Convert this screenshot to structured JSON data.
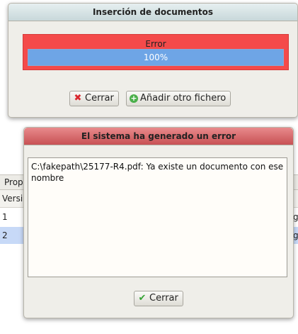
{
  "background": {
    "tab_label": "Prop",
    "column_header": "Versi",
    "rows": [
      {
        "version": "1",
        "trailing": "g"
      },
      {
        "version": "2",
        "trailing": "g"
      }
    ]
  },
  "insert_dialog": {
    "title": "Inserción de documentos",
    "status_label": "Error",
    "progress_percent": 100,
    "progress_text": "100%",
    "close_label": "Cerrar",
    "add_label": "Añadir otro fichero"
  },
  "error_dialog": {
    "title": "El sistema ha generado un error",
    "message": "C:\\fakepath\\25177-R4.pdf: Ya existe un documento con ese nombre",
    "close_label": "Cerrar"
  },
  "colors": {
    "error_box": "#f44a4a",
    "progress_fill": "#6ea5e6",
    "error_title": "#c85154",
    "insert_title": "#c8d8da"
  },
  "icons": {
    "close": "x-icon",
    "add": "plus-circle-icon",
    "confirm": "check-icon"
  }
}
